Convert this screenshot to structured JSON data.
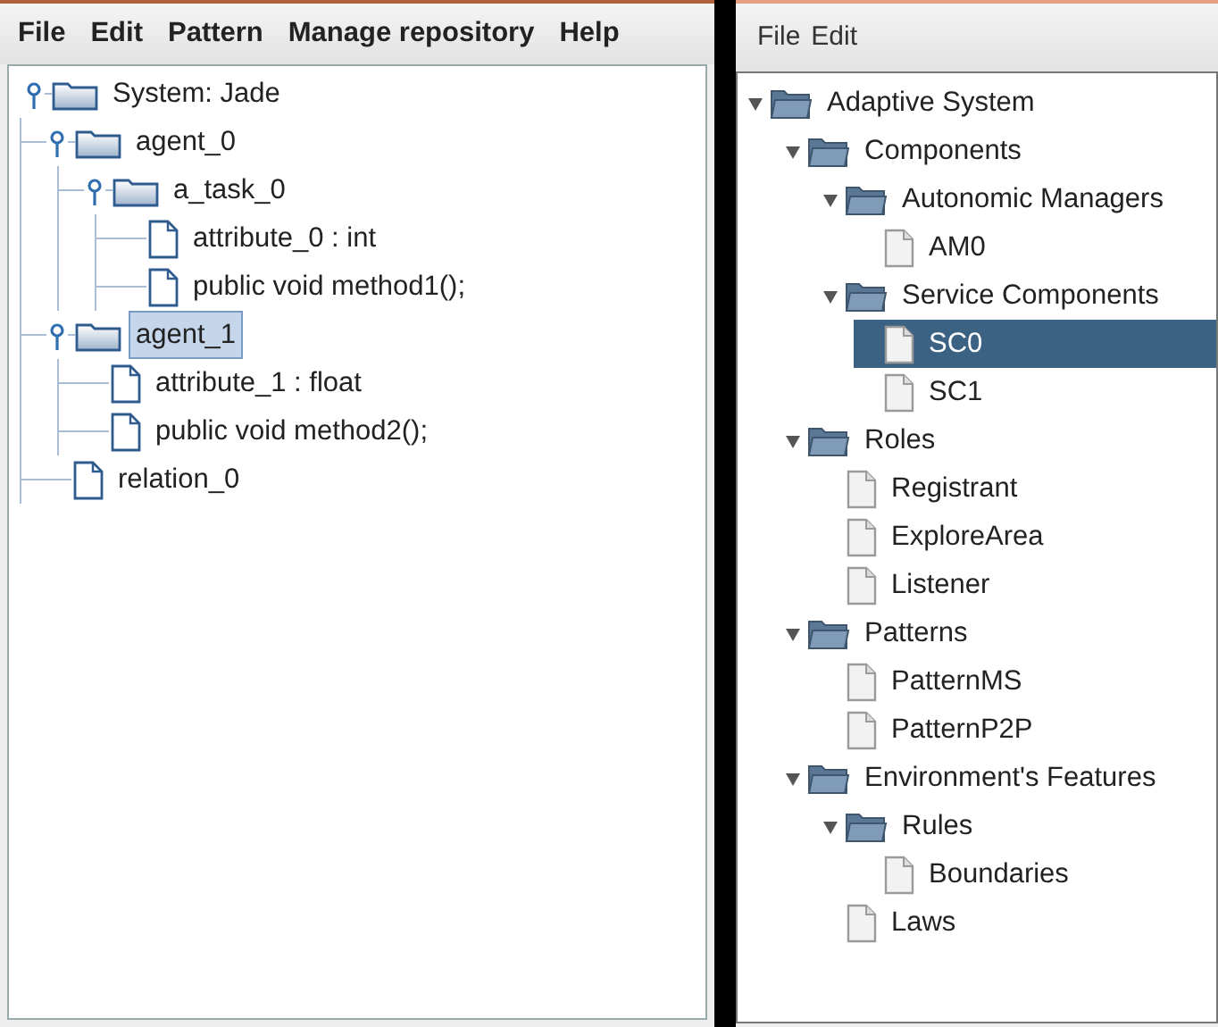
{
  "left_window": {
    "menu": [
      "File",
      "Edit",
      "Pattern",
      "Manage repository",
      "Help"
    ],
    "tree": [
      {
        "label": "System: Jade",
        "kind": "folder",
        "expanded": true,
        "selected": false,
        "children": [
          {
            "label": "agent_0",
            "kind": "folder",
            "expanded": true,
            "selected": false,
            "children": [
              {
                "label": "a_task_0",
                "kind": "folder",
                "expanded": true,
                "selected": false,
                "children": [
                  {
                    "label": "attribute_0 : int",
                    "kind": "file",
                    "selected": false
                  },
                  {
                    "label": "public void method1();",
                    "kind": "file",
                    "selected": false
                  }
                ]
              }
            ]
          },
          {
            "label": "agent_1",
            "kind": "folder",
            "expanded": true,
            "selected": true,
            "children": [
              {
                "label": "attribute_1 : float",
                "kind": "file",
                "selected": false
              },
              {
                "label": "public void method2();",
                "kind": "file",
                "selected": false
              }
            ]
          },
          {
            "label": "relation_0",
            "kind": "file",
            "selected": false
          }
        ]
      }
    ]
  },
  "right_window": {
    "menu": [
      "File",
      "Edit"
    ],
    "tree": [
      {
        "label": "Adaptive System",
        "kind": "folder",
        "expanded": true,
        "selected": false,
        "children": [
          {
            "label": "Components",
            "kind": "folder",
            "expanded": true,
            "selected": false,
            "children": [
              {
                "label": "Autonomic Managers",
                "kind": "folder",
                "expanded": true,
                "selected": false,
                "children": [
                  {
                    "label": "AM0",
                    "kind": "file",
                    "selected": false
                  }
                ]
              },
              {
                "label": "Service Components",
                "kind": "folder",
                "expanded": true,
                "selected": false,
                "children": [
                  {
                    "label": "SC0",
                    "kind": "file",
                    "selected": true
                  },
                  {
                    "label": "SC1",
                    "kind": "file",
                    "selected": false
                  }
                ]
              }
            ]
          },
          {
            "label": "Roles",
            "kind": "folder",
            "expanded": true,
            "selected": false,
            "children": [
              {
                "label": "Registrant",
                "kind": "file",
                "selected": false
              },
              {
                "label": "ExploreArea",
                "kind": "file",
                "selected": false
              },
              {
                "label": "Listener",
                "kind": "file",
                "selected": false
              }
            ]
          },
          {
            "label": "Patterns",
            "kind": "folder",
            "expanded": true,
            "selected": false,
            "children": [
              {
                "label": "PatternMS",
                "kind": "file",
                "selected": false
              },
              {
                "label": "PatternP2P",
                "kind": "file",
                "selected": false
              }
            ]
          },
          {
            "label": "Environment's Features",
            "kind": "folder",
            "expanded": true,
            "selected": false,
            "children": [
              {
                "label": "Rules",
                "kind": "folder",
                "expanded": true,
                "selected": false,
                "children": [
                  {
                    "label": "Boundaries",
                    "kind": "file",
                    "selected": false
                  }
                ]
              },
              {
                "label": "Laws",
                "kind": "file",
                "selected": false
              }
            ]
          }
        ]
      }
    ]
  }
}
